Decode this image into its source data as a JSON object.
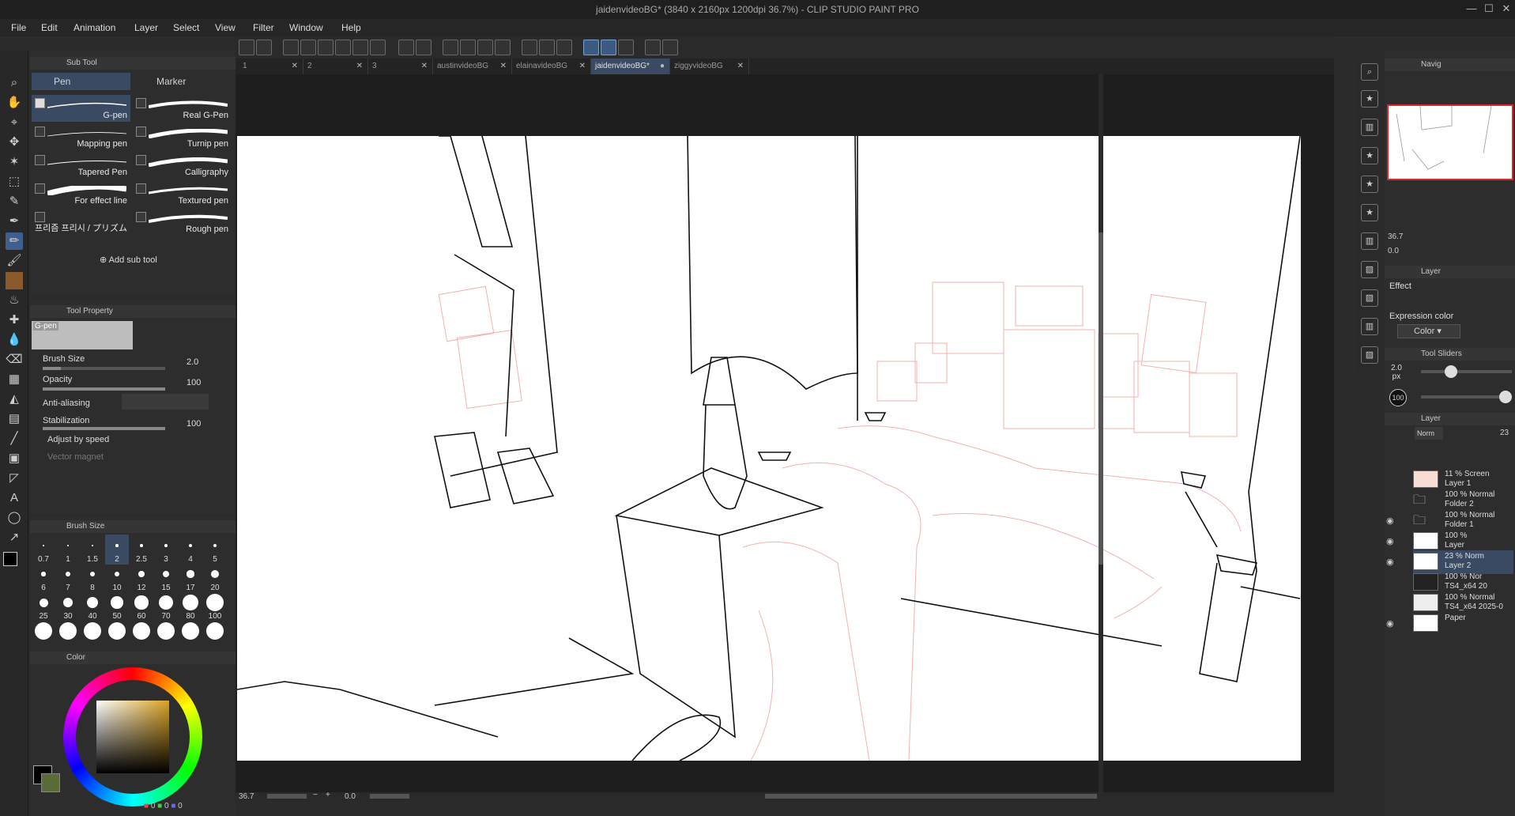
{
  "window": {
    "title": "jaidenvideoBG* (3840 x 2160px 1200dpi 36.7%)  - CLIP STUDIO PAINT PRO",
    "controls": [
      "—",
      "☐",
      "✕"
    ]
  },
  "menu": [
    "File",
    "Edit",
    "Animation",
    "Layer",
    "Select",
    "View",
    "Filter",
    "Window",
    "Help"
  ],
  "tabs": [
    {
      "label": "1",
      "active": false
    },
    {
      "label": "2",
      "active": false
    },
    {
      "label": "3",
      "active": false
    },
    {
      "label": "austinvideoBG",
      "active": false
    },
    {
      "label": "elainavideoBG",
      "active": false
    },
    {
      "label": "jaidenvideoBG*",
      "active": true
    },
    {
      "label": "ziggyvideoBG",
      "active": false
    }
  ],
  "sub_tool": {
    "header": "Sub Tool",
    "groups": [
      "Pen",
      "Marker"
    ],
    "brushes": [
      {
        "label": "G-pen",
        "selected": true,
        "checked": true
      },
      {
        "label": "Real G-Pen",
        "selected": false,
        "checked": false
      },
      {
        "label": "Mapping pen",
        "selected": false,
        "checked": false
      },
      {
        "label": "Turnip pen",
        "selected": false,
        "checked": false
      },
      {
        "label": "Tapered Pen",
        "selected": false,
        "checked": false
      },
      {
        "label": "Calligraphy",
        "selected": false,
        "checked": false
      },
      {
        "label": "For effect line",
        "selected": false,
        "checked": false
      },
      {
        "label": "Textured pen",
        "selected": false,
        "checked": false
      },
      {
        "label": "프리즘 프리시 / プリズム",
        "selected": false,
        "checked": false
      },
      {
        "label": "Rough pen",
        "selected": false,
        "checked": false
      }
    ],
    "add_label": "Add sub tool"
  },
  "tool_property": {
    "header": "Tool Property",
    "preview_label": "G-pen",
    "props": [
      {
        "label": "Brush Size",
        "value": "2.0",
        "fraction": 0.15
      },
      {
        "label": "Opacity",
        "value": "100",
        "fraction": 1.0
      },
      {
        "label": "Anti-aliasing",
        "value": "",
        "fraction": null
      },
      {
        "label": "Stabilization",
        "value": "100",
        "fraction": 1.0
      },
      {
        "label": "Adjust by speed",
        "value": "",
        "fraction": null
      },
      {
        "label": "Vector magnet",
        "value": "",
        "fraction": null
      }
    ]
  },
  "brush_size": {
    "header": "Brush Size",
    "sizes": [
      "0.7",
      "1",
      "1.5",
      "2",
      "2.5",
      "3",
      "4",
      "5",
      "6",
      "7",
      "8",
      "10",
      "12",
      "15",
      "17",
      "20",
      "25",
      "30",
      "40",
      "50",
      "60",
      "70",
      "80",
      "100",
      "",
      "",
      "",
      "",
      "",
      "",
      "",
      ""
    ],
    "selected": "2"
  },
  "color_panel": {
    "header": "Color",
    "rgb": [
      "0",
      "0",
      "0"
    ],
    "main_color": "#000000",
    "sub_color": "#5b6b3a"
  },
  "status": {
    "zoom": "36.7",
    "rotation": "0.0"
  },
  "navigator": {
    "header": "Navig",
    "zoom": "36.7",
    "rotation": "0.0"
  },
  "layer_property": {
    "header": "Layer",
    "effect_label": "Effect",
    "expression_label": "Expression color",
    "expression_value": "Color"
  },
  "tool_sliders": {
    "header": "Tool Sliders",
    "size_value": "2.0",
    "size_unit": "px",
    "size_fraction": 0.3,
    "opacity_value": "100",
    "opacity_fraction": 1.0
  },
  "layers_panel": {
    "header": "Layer",
    "blend": "Norm",
    "opacity": "23",
    "layers": [
      {
        "line1": "11 % Screen",
        "line2": "Layer 1",
        "visible": false,
        "selected": false,
        "thumb": "#f7ddd4"
      },
      {
        "line1": "100 % Normal",
        "line2": "Folder 2",
        "visible": false,
        "selected": false,
        "thumb": "folder"
      },
      {
        "line1": "100 % Normal",
        "line2": "Folder 1",
        "visible": true,
        "selected": false,
        "thumb": "folder"
      },
      {
        "line1": "100 %",
        "line2": "Layer",
        "visible": true,
        "selected": false,
        "thumb": "#ffffff"
      },
      {
        "line1": "23 % Norm",
        "line2": "Layer 2",
        "visible": true,
        "selected": true,
        "thumb": "#ffffff"
      },
      {
        "line1": "100 % Nor",
        "line2": "TS4_x64 20",
        "visible": false,
        "selected": false,
        "thumb": "#222222"
      },
      {
        "line1": "100 % Normal",
        "line2": "TS4_x64 2025-0",
        "visible": false,
        "selected": false,
        "thumb": "#eeeeee"
      },
      {
        "line1": "",
        "line2": "Paper",
        "visible": true,
        "selected": false,
        "thumb": "#ffffff"
      }
    ]
  }
}
